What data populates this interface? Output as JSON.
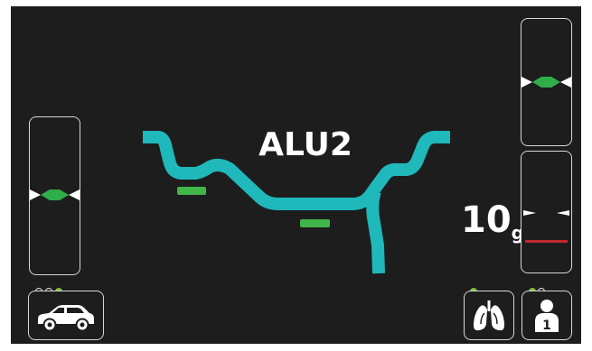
{
  "screen": {
    "rim_type": "ALU2",
    "weight": {
      "value": "10",
      "unit": "g"
    }
  },
  "colors": {
    "background": "#1d1d1d",
    "rim": "#1fb8bb",
    "weight_block": "#3fb54a",
    "marker_green": "#2fae4a",
    "marker_red": "#c1272d",
    "panel_border": "#d8d8d8",
    "indicator_on": "#7cc243"
  },
  "left_plane_gauge": {
    "marker": "green"
  },
  "right_top_gauge": {
    "marker": "green"
  },
  "right_bottom_gauge": {
    "marker": "white",
    "limit_line": "red"
  },
  "vehicle_button": {
    "icon": "car-icon",
    "indicators": [
      "off",
      "off",
      "on"
    ]
  },
  "mode_button": {
    "icon": "lungs-icon",
    "indicators": [
      "on"
    ]
  },
  "user_button": {
    "icon": "user-1-icon",
    "user_number": "1",
    "indicators": [
      "on",
      "off"
    ]
  }
}
